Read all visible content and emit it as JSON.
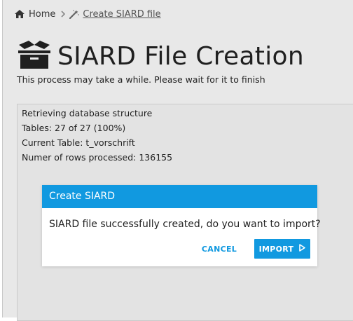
{
  "breadcrumb": {
    "home_label": "Home",
    "current_label": "Create SIARD file"
  },
  "header": {
    "title": "SIARD File Creation",
    "subtitle": "This process may take a while. Please wait for it to finish"
  },
  "progress": {
    "lines": [
      "Retrieving database structure",
      "Tables: 27 of 27 (100%)",
      "Current Table: t_vorschrift",
      "Numer of rows processed: 136155"
    ]
  },
  "dialog": {
    "title": "Create SIARD",
    "message": "SIARD file successfully created, do you want to import?",
    "cancel_label": "CANCEL",
    "import_label": "IMPORT"
  },
  "icons": {
    "home": "home-icon",
    "separator": "chevron-right-icon",
    "create": "magic-wand-icon",
    "title": "open-box-icon",
    "import": "play-icon"
  },
  "colors": {
    "accent": "#1199e0",
    "page_background": "#e8e8e8"
  }
}
